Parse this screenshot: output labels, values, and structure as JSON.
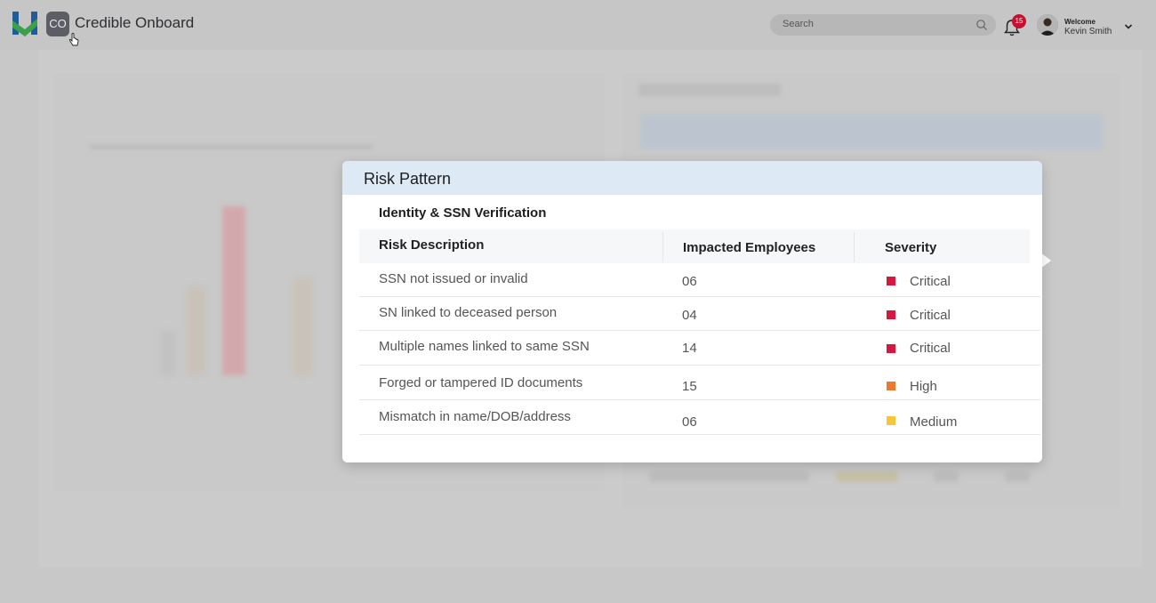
{
  "header": {
    "app_badge": "CO",
    "app_name": "Credible Onboard",
    "search_placeholder": "Search",
    "notification_count": "15",
    "welcome_label": "Welcome",
    "user_name": "Kevin Smith"
  },
  "modal": {
    "title": "Risk Pattern",
    "section_title": "Identity & SSN Verification",
    "columns": [
      "Risk Description",
      "Impacted Employees",
      "Severity"
    ],
    "rows": [
      {
        "description": "SSN not issued or invalid",
        "impacted": "06",
        "severity": "Critical",
        "color": "#d6173f"
      },
      {
        "description": "SN linked to deceased person",
        "impacted": "04",
        "severity": "Critical",
        "color": "#d6173f"
      },
      {
        "description": "Multiple names linked to same SSN",
        "impacted": "14",
        "severity": "Critical",
        "color": "#d6173f"
      },
      {
        "description": "Forged or tampered ID documents",
        "impacted": "15",
        "severity": "High",
        "color": "#ea7a2f"
      },
      {
        "description": "Mismatch in name/DOB/address",
        "impacted": "06",
        "severity": "Medium",
        "color": "#f5c637"
      }
    ]
  },
  "colors": {
    "modal_header_bg": "#dde9f5",
    "badge_red": "#c8102e"
  }
}
